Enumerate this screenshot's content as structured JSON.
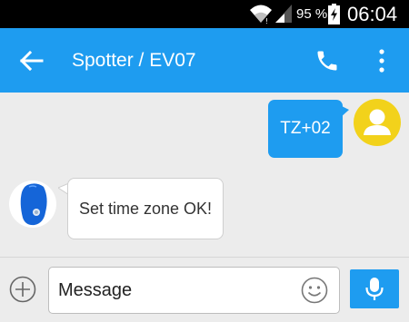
{
  "status_bar": {
    "battery_percent": "95 %",
    "time": "06:04",
    "icons": [
      "wifi-icon",
      "signal-icon",
      "battery-charging-icon"
    ]
  },
  "app_bar": {
    "title": "Spotter / EV07",
    "icons": [
      "back-arrow-icon",
      "phone-icon",
      "more-vert-icon"
    ]
  },
  "messages": [
    {
      "direction": "outgoing",
      "text": "TZ+02",
      "avatar": "user-avatar-icon"
    },
    {
      "direction": "incoming",
      "text": "Set time zone OK!",
      "avatar": "gps-tracker-device-icon"
    }
  ],
  "composer": {
    "placeholder": "Message",
    "icons": [
      "add-circle-icon",
      "emoji-icon",
      "mic-icon"
    ]
  },
  "colors": {
    "accent": "#1e9cf0",
    "status_bar": "#000000",
    "background": "#ececec",
    "user_avatar": "#f2d21b",
    "device_blue": "#1565d8"
  }
}
